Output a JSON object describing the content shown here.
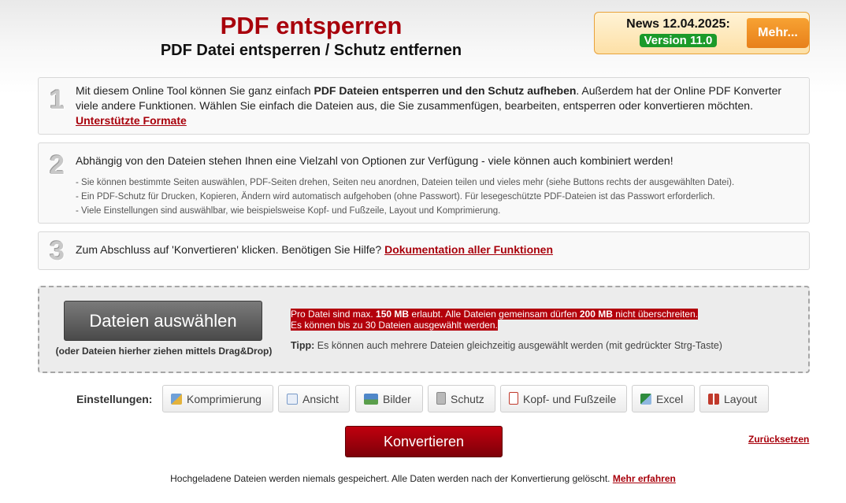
{
  "header": {
    "title": "PDF entsperren",
    "subtitle": "PDF Datei entsperren / Schutz entfernen"
  },
  "news": {
    "label": "News 12.04.2025:",
    "version": "Version 11.0",
    "more_label": "Mehr..."
  },
  "steps": [
    {
      "number": "1",
      "text_before": "Mit diesem Online Tool können Sie ganz einfach ",
      "text_bold": "PDF Dateien entsperren und den Schutz aufheben",
      "text_after": ". Außerdem hat der Online PDF Konverter viele andere Funktionen. Wählen Sie einfach die Dateien aus, die Sie zusammenfügen, bearbeiten, entsperren oder konvertieren möchten.",
      "link": "Unterstützte Formate"
    },
    {
      "number": "2",
      "text": "Abhängig von den Dateien stehen Ihnen eine Vielzahl von Optionen zur Verfügung - viele können auch kombiniert werden!",
      "bullets": [
        "- Sie können bestimmte Seiten auswählen, PDF-Seiten drehen, Seiten neu anordnen, Dateien teilen und vieles mehr (siehe Buttons rechts der ausgewählten Datei).",
        "- Ein PDF-Schutz für Drucken, Kopieren, Ändern wird automatisch aufgehoben (ohne Passwort). Für lesegeschützte PDF-Dateien ist das Passwort erforderlich.",
        "- Viele Einstellungen sind auswählbar, wie beispielsweise Kopf- und Fußzeile, Layout und Komprimierung."
      ]
    },
    {
      "number": "3",
      "text": "Zum Abschluss auf 'Konvertieren' klicken. Benötigen Sie Hilfe? ",
      "link": "Dokumentation aller Funktionen"
    }
  ],
  "upload": {
    "button_label": "Dateien auswählen",
    "drag_hint": "(oder Dateien hierher ziehen mittels Drag&Drop)",
    "limit_1a": "Pro Datei sind max. ",
    "limit_1b": "150 MB",
    "limit_1c": " erlaubt. Alle Dateien gemeinsam dürfen ",
    "limit_1d": "200 MB",
    "limit_1e": " nicht überschreiten.",
    "limit_2": "Es können bis zu 30 Dateien ausgewählt werden.",
    "tip_label": "Tipp:",
    "tip_text": " Es können auch mehrere Dateien gleichzeitig ausgewählt werden (mit gedrückter Strg-Taste)"
  },
  "settings": {
    "label": "Einstellungen:",
    "options": [
      {
        "label": "Komprimierung",
        "icon": "compress-icon"
      },
      {
        "label": "Ansicht",
        "icon": "view-icon"
      },
      {
        "label": "Bilder",
        "icon": "image-icon"
      },
      {
        "label": "Schutz",
        "icon": "lock-icon"
      },
      {
        "label": "Kopf- und Fußzeile",
        "icon": "header-footer-icon"
      },
      {
        "label": "Excel",
        "icon": "excel-icon"
      },
      {
        "label": "Layout",
        "icon": "layout-icon"
      }
    ]
  },
  "actions": {
    "convert_label": "Konvertieren",
    "reset_label": "Zurücksetzen"
  },
  "footer": {
    "text": "Hochgeladene Dateien werden niemals gespeichert. Alle Daten werden nach der Konvertierung gelöscht. ",
    "link": "Mehr erfahren"
  },
  "colors": {
    "brand_red": "#a8000b",
    "news_green": "#1b9a2a",
    "more_orange": "#f39223"
  }
}
